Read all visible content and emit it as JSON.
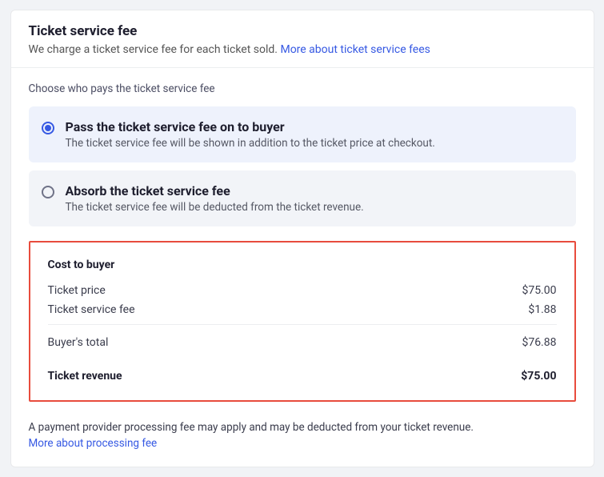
{
  "header": {
    "title": "Ticket service fee",
    "subtitle_text": "We charge a ticket service fee for each ticket sold. ",
    "subtitle_link": "More about ticket service fees"
  },
  "choose_label": "Choose who pays the ticket service fee",
  "options": [
    {
      "title": "Pass the ticket service fee on to buyer",
      "desc": "The ticket service fee will be shown in addition to the ticket price at checkout.",
      "selected": true
    },
    {
      "title": "Absorb the ticket service fee",
      "desc": "The ticket service fee will be deducted from the ticket revenue.",
      "selected": false
    }
  ],
  "cost_box": {
    "heading": "Cost to buyer",
    "rows": [
      {
        "label": "Ticket price",
        "value": "$75.00"
      },
      {
        "label": "Ticket service fee",
        "value": "$1.88"
      }
    ],
    "total": {
      "label": "Buyer's total",
      "value": "$76.88"
    },
    "revenue": {
      "label": "Ticket revenue",
      "value": "$75.00"
    }
  },
  "footer": {
    "text": "A payment provider processing fee may apply and may be deducted from your ticket revenue.",
    "link": "More about processing fee"
  }
}
